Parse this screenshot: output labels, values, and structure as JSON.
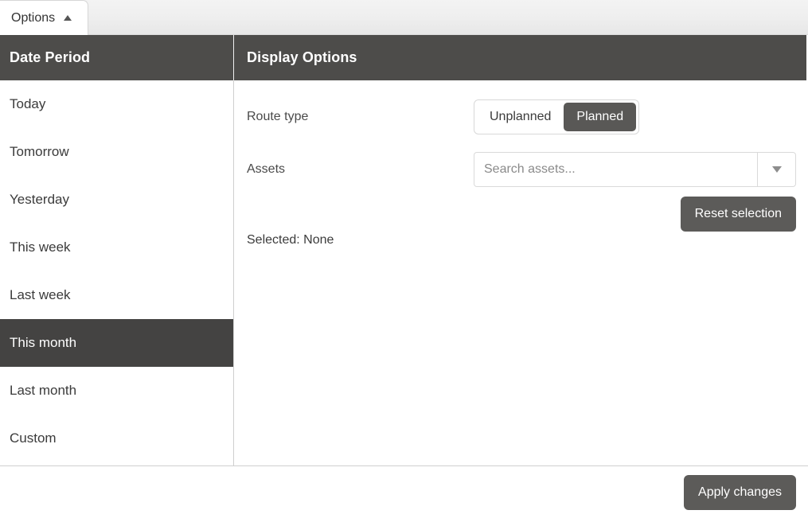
{
  "tab": {
    "label": "Options",
    "caret_icon": "caret-up-icon"
  },
  "headers": {
    "date_period": "Date Period",
    "display_options": "Display Options"
  },
  "sidebar": {
    "items": [
      {
        "label": "Today",
        "selected": false
      },
      {
        "label": "Tomorrow",
        "selected": false
      },
      {
        "label": "Yesterday",
        "selected": false
      },
      {
        "label": "This week",
        "selected": false
      },
      {
        "label": "Last week",
        "selected": false
      },
      {
        "label": "This month",
        "selected": true
      },
      {
        "label": "Last month",
        "selected": false
      },
      {
        "label": "Custom",
        "selected": false
      }
    ]
  },
  "display_options": {
    "route_type": {
      "label": "Route type",
      "options": [
        {
          "label": "Unplanned",
          "active": false
        },
        {
          "label": "Planned",
          "active": true
        }
      ],
      "selected": "Planned"
    },
    "assets": {
      "label": "Assets",
      "search_placeholder": "Search assets...",
      "search_value": "",
      "dropdown_icon": "caret-down-icon",
      "reset_button": "Reset selection",
      "selected_summary": "Selected: None"
    }
  },
  "footer": {
    "apply_button": "Apply changes"
  },
  "colors": {
    "header_dark": "#4d4c4a",
    "selected_item": "#444342",
    "button_dark": "#5c5b59",
    "toggle_active": "#595856",
    "topbar_gray": "#eeeeee",
    "text_primary": "#3b3b3b",
    "placeholder": "#8a8a8a",
    "border": "#cfcfcf"
  }
}
